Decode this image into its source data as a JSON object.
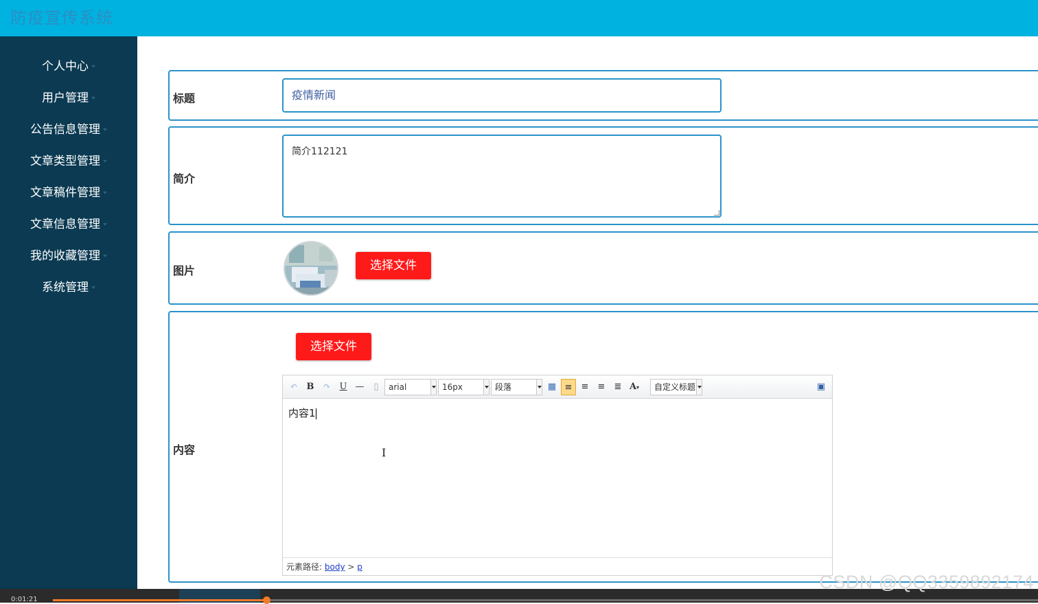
{
  "app": {
    "title": "防疫宣传系统"
  },
  "sidebar": {
    "items": [
      {
        "label": "个人中心"
      },
      {
        "label": "用户管理"
      },
      {
        "label": "公告信息管理"
      },
      {
        "label": "文章类型管理"
      },
      {
        "label": "文章稿件管理"
      },
      {
        "label": "文章信息管理"
      },
      {
        "label": "我的收藏管理"
      },
      {
        "label": "系统管理"
      }
    ]
  },
  "form": {
    "title_label": "标题",
    "title_value": "疫情新闻",
    "intro_label": "简介",
    "intro_value": "简介112121",
    "image_label": "图片",
    "image_button": "选择文件",
    "content_label": "内容",
    "content_button": "选择文件"
  },
  "editor": {
    "font_family": "arial",
    "font_size": "16px",
    "paragraph": "段落",
    "custom_heading": "自定义标题",
    "body_text": "内容1",
    "path_label": "元素路径:",
    "path_body": "body",
    "path_sep": ">",
    "path_p": "p",
    "icons": [
      "undo-icon",
      "bold-icon",
      "redo-icon",
      "underline-icon",
      "horizontal-rule-icon",
      "paste-icon",
      "table-icon",
      "align-left-icon",
      "align-right-icon",
      "align-center-icon",
      "justify-icon",
      "font-color-icon",
      "preview-icon"
    ]
  },
  "video": {
    "time": "0:01:21",
    "progress": 0.217
  },
  "watermark": "CSDN @QQ3359892174",
  "colors": {
    "header": "#00b2e0",
    "sidebar": "#0b3a52",
    "border": "#2a93c9",
    "button": "#ff1a1a",
    "progress": "#f27a28"
  }
}
